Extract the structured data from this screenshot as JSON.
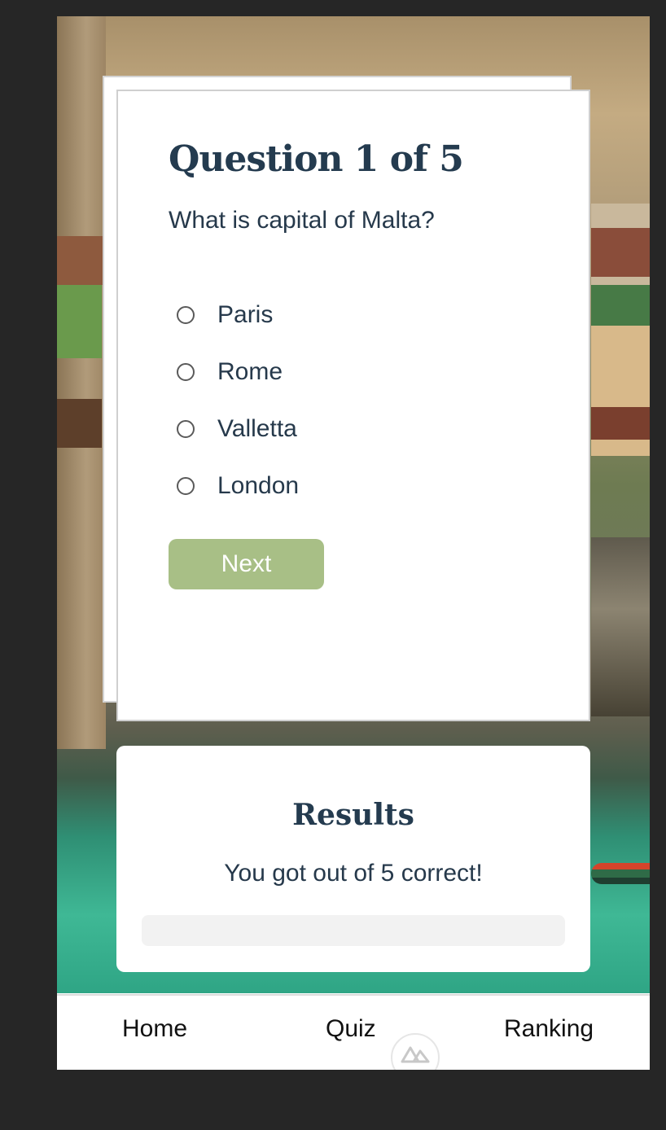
{
  "quiz": {
    "title": "Question 1 of 5",
    "question": "What is capital of Malta?",
    "options": [
      {
        "label": "Paris",
        "selected": false
      },
      {
        "label": "Rome",
        "selected": false
      },
      {
        "label": "Valletta",
        "selected": false
      },
      {
        "label": "London",
        "selected": false
      }
    ],
    "next_label": "Next"
  },
  "results": {
    "title": "Results",
    "summary": "You got out of 5 correct!",
    "progress": 0
  },
  "nav": {
    "home": "Home",
    "quiz": "Quiz",
    "ranking": "Ranking",
    "badge_icon": "nuxt-logo-icon"
  },
  "colors": {
    "accent": "#a8bf86",
    "heading": "#243b4f",
    "text": "#26394b",
    "outer_background": "#262626"
  }
}
